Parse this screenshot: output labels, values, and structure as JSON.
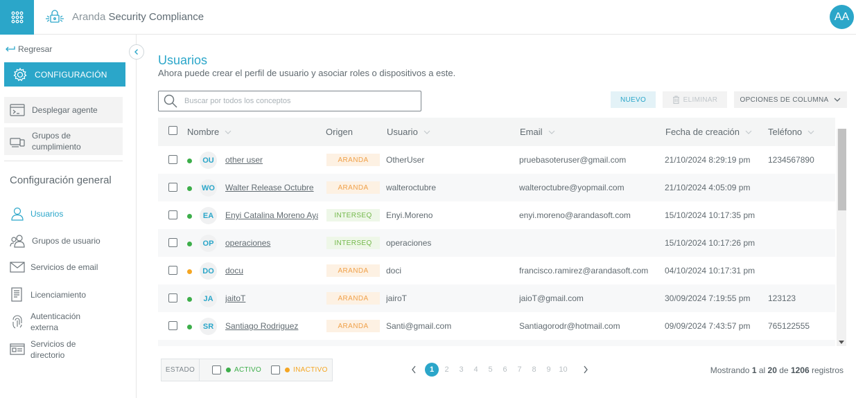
{
  "app": {
    "brand": "Aranda",
    "product": "Security Compliance",
    "user_initials": "AA"
  },
  "sidebar": {
    "back_label": "Regresar",
    "config_label": "CONFIGURACIÓN",
    "cards": [
      {
        "label": "Desplegar agente"
      },
      {
        "label": "Grupos de cumplimiento"
      }
    ],
    "section_title": "Configuración general",
    "items": [
      {
        "label": "Usuarios",
        "icon": "user-icon",
        "active": true
      },
      {
        "label": "Grupos de usuario",
        "icon": "user-group-icon"
      },
      {
        "label": "Servicios de email",
        "icon": "email-icon"
      },
      {
        "label": "Licenciamiento",
        "icon": "license-icon"
      },
      {
        "label": "Autenticación externa",
        "icon": "fingerprint-icon"
      },
      {
        "label": "Servicios de directorio",
        "icon": "directory-icon"
      }
    ]
  },
  "page": {
    "title": "Usuarios",
    "subtitle": "Ahora puede crear el perfil de usuario y asociar roles o dispositivos a este."
  },
  "search": {
    "placeholder": "Buscar por todos los conceptos",
    "value": ""
  },
  "toolbar": {
    "new_label": "NUEVO",
    "delete_label": "ELIMINAR",
    "columns_label": "OPCIONES DE COLUMNA"
  },
  "table": {
    "headers": {
      "name": "Nombre",
      "origin": "Origen",
      "user": "Usuario",
      "email": "Email",
      "created": "Fecha de creación",
      "phone": "Teléfono"
    },
    "rows": [
      {
        "status": "active",
        "initials": "OU",
        "name": "other user",
        "origin": "ARANDA",
        "user": "OtherUser",
        "email": "pruebasoteruser@gmail.com",
        "created": "21/10/2024 8:29:19 pm",
        "phone": "1234567890"
      },
      {
        "status": "active",
        "initials": "WO",
        "name": "Walter Release Octubre",
        "origin": "ARANDA",
        "user": "walteroctubre",
        "email": "walteroctubre@yopmail.com",
        "created": "21/10/2024 4:05:09 pm",
        "phone": ""
      },
      {
        "status": "active",
        "initials": "EA",
        "name": "Enyi Catalina Moreno Ayala",
        "origin": "INTERSEQ",
        "user": "Enyi.Moreno",
        "email": "enyi.moreno@arandasoft.com",
        "created": "15/10/2024 10:17:35 pm",
        "phone": ""
      },
      {
        "status": "active",
        "initials": "OP",
        "name": "operaciones",
        "origin": "INTERSEQ",
        "user": "operaciones",
        "email": "",
        "created": "15/10/2024 10:17:26 pm",
        "phone": ""
      },
      {
        "status": "inactive",
        "initials": "DO",
        "name": "docu",
        "origin": "ARANDA",
        "user": "doci",
        "email": "francisco.ramirez@arandasoft.com",
        "created": "04/10/2024 10:17:31 pm",
        "phone": ""
      },
      {
        "status": "active",
        "initials": "JA",
        "name": "jaitoT",
        "origin": "ARANDA",
        "user": "jairoT",
        "email": "jaioT@gmail.com",
        "created": "30/09/2024 7:19:55 pm",
        "phone": "123123"
      },
      {
        "status": "active",
        "initials": "SR",
        "name": "Santiago Rodriguez",
        "origin": "ARANDA",
        "user": "Santi@gmail.com",
        "email": "Santiagorodr@hotmail.com",
        "created": "09/09/2024 7:43:57 pm",
        "phone": "765122555"
      }
    ]
  },
  "footer": {
    "estado_label": "ESTADO",
    "active_label": "ACTIVO",
    "inactive_label": "INACTIVO",
    "pages": [
      "1",
      "2",
      "3",
      "4",
      "5",
      "6",
      "7",
      "8",
      "9",
      "10"
    ],
    "current_page": "1",
    "records_prefix": "Mostrando",
    "records_from": "1",
    "records_al": "al",
    "records_to": "20",
    "records_de": "de",
    "records_total": "1206",
    "records_suffix": "registros"
  },
  "colors": {
    "accent": "#2ba6c9",
    "active": "#3dae4a",
    "inactive": "#f5a623",
    "aranda_badge": "#f0a14a",
    "interseq_badge": "#73b84a"
  }
}
